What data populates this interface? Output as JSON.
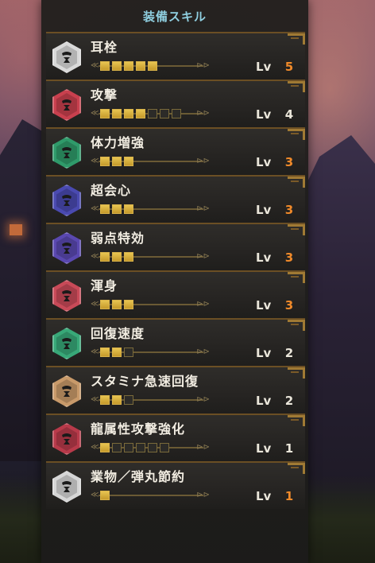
{
  "panel": {
    "title": "装備スキル"
  },
  "level_label": "Lv",
  "colors": {
    "title": "#8fcfe0",
    "max_level": "#f08a2a",
    "normal_level": "#eae6da",
    "pip_on": "#d8b24a"
  },
  "skills": [
    {
      "name": "耳栓",
      "level": "5",
      "max_level": 5,
      "at_max": true,
      "emblem_color": "#d9d9d9",
      "icon": "skill-jewel-icon"
    },
    {
      "name": "攻撃",
      "level": "4",
      "max_level": 7,
      "at_max": false,
      "emblem_color": "#c8404e",
      "icon": "skill-jewel-icon"
    },
    {
      "name": "体力増強",
      "level": "3",
      "max_level": 3,
      "at_max": true,
      "emblem_color": "#2f9a6a",
      "icon": "skill-jewel-icon"
    },
    {
      "name": "超会心",
      "level": "3",
      "max_level": 3,
      "at_max": true,
      "emblem_color": "#4a4ab0",
      "icon": "skill-jewel-icon"
    },
    {
      "name": "弱点特効",
      "level": "3",
      "max_level": 3,
      "at_max": true,
      "emblem_color": "#5a48b0",
      "icon": "skill-jewel-icon"
    },
    {
      "name": "渾身",
      "level": "3",
      "max_level": 3,
      "at_max": true,
      "emblem_color": "#c84a58",
      "icon": "skill-jewel-icon"
    },
    {
      "name": "回復速度",
      "level": "2",
      "max_level": 3,
      "at_max": false,
      "emblem_color": "#38a878",
      "icon": "skill-jewel-icon"
    },
    {
      "name": "スタミナ急速回復",
      "level": "2",
      "max_level": 3,
      "at_max": false,
      "emblem_color": "#c89a6a",
      "icon": "skill-jewel-icon"
    },
    {
      "name": "龍属性攻撃強化",
      "level": "1",
      "max_level": 6,
      "at_max": false,
      "emblem_color": "#b83a4a",
      "icon": "skill-jewel-icon"
    },
    {
      "name": "業物／弾丸節約",
      "level": "1",
      "max_level": 1,
      "at_max": true,
      "emblem_color": "#d6d6d6",
      "icon": "skill-jewel-icon"
    }
  ]
}
